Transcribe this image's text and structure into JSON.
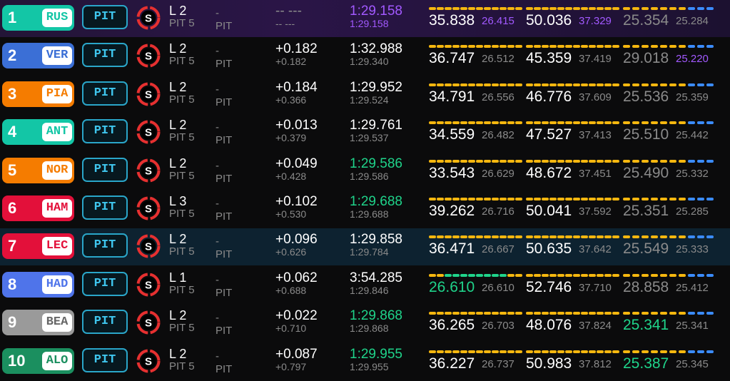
{
  "colors": {
    "purple": "#a259ff",
    "green": "#1fd38a",
    "yellow_segment": "#f5b70f",
    "blue_segment": "#3b8cff",
    "pit_border": "#2aa6c9",
    "tyre_soft": "#e63030"
  },
  "pit_label": "PIT",
  "tyre_letter": "S",
  "rows": [
    {
      "pos": "1",
      "code": "RUS",
      "team_color": "#13c6a6",
      "code_color": "#13c6a6",
      "highlight": "purple",
      "lap": "L 2",
      "lap_sub": "PIT 5",
      "status": "-",
      "status_sub": "PIT",
      "gap": "-- ---",
      "gap_sub": "-- ---",
      "gap_dash": true,
      "time": "1:29.158",
      "time_color": "purple",
      "time_sub": "1:29.158",
      "time_sub_color": "purple",
      "s1": "35.838",
      "s1_color": "white",
      "s1b": "26.415",
      "s1b_color": "purple",
      "s1_segs": [
        "y",
        "y",
        "y",
        "y",
        "y",
        "y",
        "y",
        "y",
        "y",
        "y",
        "y",
        "y"
      ],
      "s2": "50.036",
      "s2_color": "white",
      "s2b": "37.329",
      "s2b_color": "purple",
      "s2_segs": [
        "y",
        "y",
        "y",
        "y",
        "y",
        "y",
        "y",
        "y",
        "y",
        "y",
        "y",
        "y"
      ],
      "s3": "25.354",
      "s3_color": "grey",
      "s3b": "25.284",
      "s3b_color": "grey",
      "s3_segs": [
        "y",
        "y",
        "y",
        "y",
        "y",
        "y",
        "y",
        "b",
        "b",
        "b"
      ]
    },
    {
      "pos": "2",
      "code": "VER",
      "team_color": "#3b6fd6",
      "code_color": "#3b6fd6",
      "highlight": "",
      "lap": "L 2",
      "lap_sub": "PIT 5",
      "status": "-",
      "status_sub": "PIT",
      "gap": "+0.182",
      "gap_sub": "+0.182",
      "gap_dash": false,
      "time": "1:32.988",
      "time_color": "white",
      "time_sub": "1:29.340",
      "time_sub_color": "grey",
      "s1": "36.747",
      "s1_color": "white",
      "s1b": "26.512",
      "s1b_color": "grey",
      "s1_segs": [
        "y",
        "y",
        "y",
        "y",
        "y",
        "y",
        "y",
        "y",
        "y",
        "y",
        "y",
        "y"
      ],
      "s2": "45.359",
      "s2_color": "white",
      "s2b": "37.419",
      "s2b_color": "grey",
      "s2_segs": [
        "y",
        "y",
        "y",
        "y",
        "y",
        "y",
        "y",
        "y",
        "y",
        "y",
        "y",
        "y"
      ],
      "s3": "29.018",
      "s3_color": "grey",
      "s3b": "25.220",
      "s3b_color": "purple",
      "s3_segs": [
        "y",
        "y",
        "y",
        "y",
        "y",
        "y",
        "y",
        "b",
        "b",
        "b"
      ]
    },
    {
      "pos": "3",
      "code": "PIA",
      "team_color": "#f57c00",
      "code_color": "#f57c00",
      "highlight": "",
      "lap": "L 2",
      "lap_sub": "PIT 5",
      "status": "-",
      "status_sub": "PIT",
      "gap": "+0.184",
      "gap_sub": "+0.366",
      "gap_dash": false,
      "time": "1:29.952",
      "time_color": "white",
      "time_sub": "1:29.524",
      "time_sub_color": "grey",
      "s1": "34.791",
      "s1_color": "white",
      "s1b": "26.556",
      "s1b_color": "grey",
      "s1_segs": [
        "y",
        "y",
        "y",
        "y",
        "y",
        "y",
        "y",
        "y",
        "y",
        "y",
        "y",
        "y"
      ],
      "s2": "46.776",
      "s2_color": "white",
      "s2b": "37.609",
      "s2b_color": "grey",
      "s2_segs": [
        "y",
        "y",
        "y",
        "y",
        "y",
        "y",
        "y",
        "y",
        "y",
        "y",
        "y",
        "y"
      ],
      "s3": "25.536",
      "s3_color": "grey",
      "s3b": "25.359",
      "s3b_color": "grey",
      "s3_segs": [
        "y",
        "y",
        "y",
        "y",
        "y",
        "y",
        "y",
        "b",
        "b",
        "b"
      ]
    },
    {
      "pos": "4",
      "code": "ANT",
      "team_color": "#13c6a6",
      "code_color": "#13c6a6",
      "highlight": "",
      "lap": "L 2",
      "lap_sub": "PIT 5",
      "status": "-",
      "status_sub": "PIT",
      "gap": "+0.013",
      "gap_sub": "+0.379",
      "gap_dash": false,
      "time": "1:29.761",
      "time_color": "white",
      "time_sub": "1:29.537",
      "time_sub_color": "grey",
      "s1": "34.559",
      "s1_color": "white",
      "s1b": "26.482",
      "s1b_color": "grey",
      "s1_segs": [
        "y",
        "y",
        "y",
        "y",
        "y",
        "y",
        "y",
        "y",
        "y",
        "y",
        "y",
        "y"
      ],
      "s2": "47.527",
      "s2_color": "white",
      "s2b": "37.413",
      "s2b_color": "grey",
      "s2_segs": [
        "y",
        "y",
        "y",
        "y",
        "y",
        "y",
        "y",
        "y",
        "y",
        "y",
        "y",
        "y"
      ],
      "s3": "25.510",
      "s3_color": "grey",
      "s3b": "25.442",
      "s3b_color": "grey",
      "s3_segs": [
        "y",
        "y",
        "y",
        "y",
        "y",
        "y",
        "y",
        "b",
        "b",
        "b"
      ]
    },
    {
      "pos": "5",
      "code": "NOR",
      "team_color": "#f57c00",
      "code_color": "#f57c00",
      "highlight": "",
      "lap": "L 2",
      "lap_sub": "PIT 5",
      "status": "-",
      "status_sub": "PIT",
      "gap": "+0.049",
      "gap_sub": "+0.428",
      "gap_dash": false,
      "time": "1:29.586",
      "time_color": "green",
      "time_sub": "1:29.586",
      "time_sub_color": "grey",
      "s1": "33.543",
      "s1_color": "white",
      "s1b": "26.629",
      "s1b_color": "grey",
      "s1_segs": [
        "y",
        "y",
        "y",
        "y",
        "y",
        "y",
        "y",
        "y",
        "y",
        "y",
        "y",
        "y"
      ],
      "s2": "48.672",
      "s2_color": "white",
      "s2b": "37.451",
      "s2b_color": "grey",
      "s2_segs": [
        "y",
        "y",
        "y",
        "y",
        "y",
        "y",
        "y",
        "y",
        "y",
        "y",
        "y",
        "y"
      ],
      "s3": "25.490",
      "s3_color": "grey",
      "s3b": "25.332",
      "s3b_color": "grey",
      "s3_segs": [
        "y",
        "y",
        "y",
        "y",
        "y",
        "y",
        "y",
        "b",
        "b",
        "b"
      ]
    },
    {
      "pos": "6",
      "code": "HAM",
      "team_color": "#e3103a",
      "code_color": "#e3103a",
      "highlight": "",
      "lap": "L 3",
      "lap_sub": "PIT 5",
      "status": "-",
      "status_sub": "PIT",
      "gap": "+0.102",
      "gap_sub": "+0.530",
      "gap_dash": false,
      "time": "1:29.688",
      "time_color": "green",
      "time_sub": "1:29.688",
      "time_sub_color": "grey",
      "s1": "39.262",
      "s1_color": "white",
      "s1b": "26.716",
      "s1b_color": "grey",
      "s1_segs": [
        "y",
        "y",
        "y",
        "y",
        "y",
        "y",
        "y",
        "y",
        "y",
        "y",
        "y",
        "y"
      ],
      "s2": "50.041",
      "s2_color": "white",
      "s2b": "37.592",
      "s2b_color": "grey",
      "s2_segs": [
        "y",
        "y",
        "y",
        "y",
        "y",
        "y",
        "y",
        "y",
        "y",
        "y",
        "y",
        "y"
      ],
      "s3": "25.351",
      "s3_color": "grey",
      "s3b": "25.285",
      "s3b_color": "grey",
      "s3_segs": [
        "y",
        "y",
        "y",
        "y",
        "y",
        "y",
        "y",
        "b",
        "b",
        "b"
      ]
    },
    {
      "pos": "7",
      "code": "LEC",
      "team_color": "#e3103a",
      "code_color": "#e3103a",
      "highlight": "blue",
      "lap": "L 2",
      "lap_sub": "PIT 5",
      "status": "-",
      "status_sub": "PIT",
      "gap": "+0.096",
      "gap_sub": "+0.626",
      "gap_dash": false,
      "time": "1:29.858",
      "time_color": "white",
      "time_sub": "1:29.784",
      "time_sub_color": "grey",
      "s1": "36.471",
      "s1_color": "white",
      "s1b": "26.667",
      "s1b_color": "grey",
      "s1_segs": [
        "y",
        "y",
        "y",
        "y",
        "y",
        "y",
        "y",
        "y",
        "y",
        "y",
        "y",
        "y"
      ],
      "s2": "50.635",
      "s2_color": "white",
      "s2b": "37.642",
      "s2b_color": "grey",
      "s2_segs": [
        "y",
        "y",
        "y",
        "y",
        "y",
        "y",
        "y",
        "y",
        "y",
        "y",
        "y",
        "y"
      ],
      "s3": "25.549",
      "s3_color": "grey",
      "s3b": "25.333",
      "s3b_color": "grey",
      "s3_segs": [
        "y",
        "y",
        "y",
        "y",
        "y",
        "y",
        "y",
        "b",
        "b",
        "b"
      ]
    },
    {
      "pos": "8",
      "code": "HAD",
      "team_color": "#4f74ea",
      "code_color": "#4f74ea",
      "highlight": "",
      "lap": "L 1",
      "lap_sub": "PIT 5",
      "status": "-",
      "status_sub": "PIT",
      "gap": "+0.062",
      "gap_sub": "+0.688",
      "gap_dash": false,
      "time": "3:54.285",
      "time_color": "white",
      "time_sub": "1:29.846",
      "time_sub_color": "grey",
      "s1": "26.610",
      "s1_color": "green",
      "s1b": "26.610",
      "s1b_color": "grey",
      "s1_segs": [
        "y",
        "y",
        "g",
        "g",
        "g",
        "g",
        "g",
        "g",
        "g",
        "g",
        "y",
        "y"
      ],
      "s2": "52.746",
      "s2_color": "white",
      "s2b": "37.710",
      "s2b_color": "grey",
      "s2_segs": [
        "y",
        "y",
        "y",
        "y",
        "y",
        "y",
        "y",
        "y",
        "y",
        "y",
        "y",
        "y"
      ],
      "s3": "28.858",
      "s3_color": "grey",
      "s3b": "25.412",
      "s3b_color": "grey",
      "s3_segs": [
        "y",
        "y",
        "y",
        "y",
        "y",
        "y",
        "y",
        "b",
        "b",
        "b"
      ]
    },
    {
      "pos": "9",
      "code": "BEA",
      "team_color": "#9a9a9a",
      "code_color": "#666666",
      "highlight": "",
      "lap": "L 2",
      "lap_sub": "PIT 5",
      "status": "-",
      "status_sub": "PIT",
      "gap": "+0.022",
      "gap_sub": "+0.710",
      "gap_dash": false,
      "time": "1:29.868",
      "time_color": "green",
      "time_sub": "1:29.868",
      "time_sub_color": "grey",
      "s1": "36.265",
      "s1_color": "white",
      "s1b": "26.703",
      "s1b_color": "grey",
      "s1_segs": [
        "y",
        "y",
        "y",
        "y",
        "y",
        "y",
        "y",
        "y",
        "y",
        "y",
        "y",
        "y"
      ],
      "s2": "48.076",
      "s2_color": "white",
      "s2b": "37.824",
      "s2b_color": "grey",
      "s2_segs": [
        "y",
        "y",
        "y",
        "y",
        "y",
        "y",
        "y",
        "y",
        "y",
        "y",
        "y",
        "y"
      ],
      "s3": "25.341",
      "s3_color": "green",
      "s3b": "25.341",
      "s3b_color": "grey",
      "s3_segs": [
        "y",
        "y",
        "y",
        "y",
        "y",
        "y",
        "y",
        "b",
        "b",
        "b"
      ]
    },
    {
      "pos": "10",
      "code": "ALO",
      "team_color": "#1b8f5f",
      "code_color": "#1b8f5f",
      "highlight": "",
      "lap": "L 2",
      "lap_sub": "PIT 5",
      "status": "-",
      "status_sub": "PIT",
      "gap": "+0.087",
      "gap_sub": "+0.797",
      "gap_dash": false,
      "time": "1:29.955",
      "time_color": "green",
      "time_sub": "1:29.955",
      "time_sub_color": "grey",
      "s1": "36.227",
      "s1_color": "white",
      "s1b": "26.737",
      "s1b_color": "grey",
      "s1_segs": [
        "y",
        "y",
        "y",
        "y",
        "y",
        "y",
        "y",
        "y",
        "y",
        "y",
        "y",
        "y"
      ],
      "s2": "50.983",
      "s2_color": "white",
      "s2b": "37.812",
      "s2b_color": "grey",
      "s2_segs": [
        "y",
        "y",
        "y",
        "y",
        "y",
        "y",
        "y",
        "y",
        "y",
        "y",
        "y",
        "y"
      ],
      "s3": "25.387",
      "s3_color": "green",
      "s3b": "25.345",
      "s3b_color": "grey",
      "s3_segs": [
        "y",
        "y",
        "y",
        "y",
        "y",
        "y",
        "y",
        "b",
        "b",
        "b"
      ]
    }
  ]
}
